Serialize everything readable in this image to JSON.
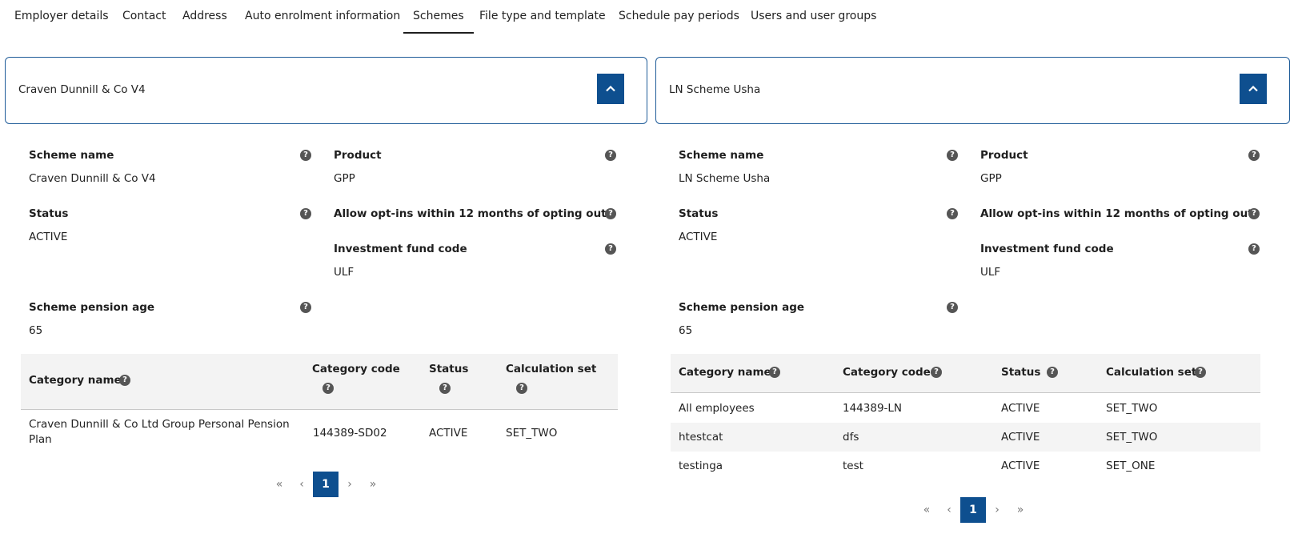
{
  "tabs": [
    {
      "label": "Employer details"
    },
    {
      "label": "Contact"
    },
    {
      "label": "Address"
    },
    {
      "label": "Auto enrolment information"
    },
    {
      "label": "Schemes",
      "active": true
    },
    {
      "label": "File type and template"
    },
    {
      "label": "Schedule pay periods"
    },
    {
      "label": "Users and user groups"
    }
  ],
  "field_labels": {
    "scheme_name": "Scheme name",
    "product": "Product",
    "status": "Status",
    "allow_opt_ins": "Allow opt-ins within 12 months of opting out",
    "investment_fund_code": "Investment fund code",
    "scheme_pension_age": "Scheme pension age"
  },
  "table_headers": {
    "category_name": "Category name",
    "category_code": "Category code",
    "status": "Status",
    "calculation_set": "Calculation set"
  },
  "help_glyph": "?",
  "pagination": {
    "first": "«",
    "prev": "‹",
    "current": "1",
    "next": "›",
    "last": "»"
  },
  "schemes": [
    {
      "title": "Craven Dunnill & Co V4",
      "scheme_name": "Craven Dunnill & Co V4",
      "product": "GPP",
      "status": "ACTIVE",
      "allow_opt_ins": "",
      "investment_fund_code": "ULF",
      "scheme_pension_age": "65",
      "categories": [
        {
          "name_line1": "Craven Dunnill & Co Ltd Group Personal Pension",
          "name_line2": "Plan",
          "code": "144389-SD02",
          "status": "ACTIVE",
          "calculation_set": "SET_TWO"
        }
      ]
    },
    {
      "title": "LN Scheme Usha",
      "scheme_name": "LN Scheme Usha",
      "product": "GPP",
      "status": "ACTIVE",
      "allow_opt_ins": "",
      "investment_fund_code": "ULF",
      "scheme_pension_age": "65",
      "categories": [
        {
          "name": "All employees",
          "code": "144389-LN",
          "status": "ACTIVE",
          "calculation_set": "SET_TWO"
        },
        {
          "name": "htestcat",
          "code": "dfs",
          "status": "ACTIVE",
          "calculation_set": "SET_TWO"
        },
        {
          "name": "testinga",
          "code": "test",
          "status": "ACTIVE",
          "calculation_set": "SET_ONE"
        }
      ]
    }
  ],
  "colors": {
    "accent": "#0e4f8f",
    "panel_border": "#1f5c99",
    "help_icon": "#555555",
    "table_header_bg": "#f3f3f3"
  }
}
